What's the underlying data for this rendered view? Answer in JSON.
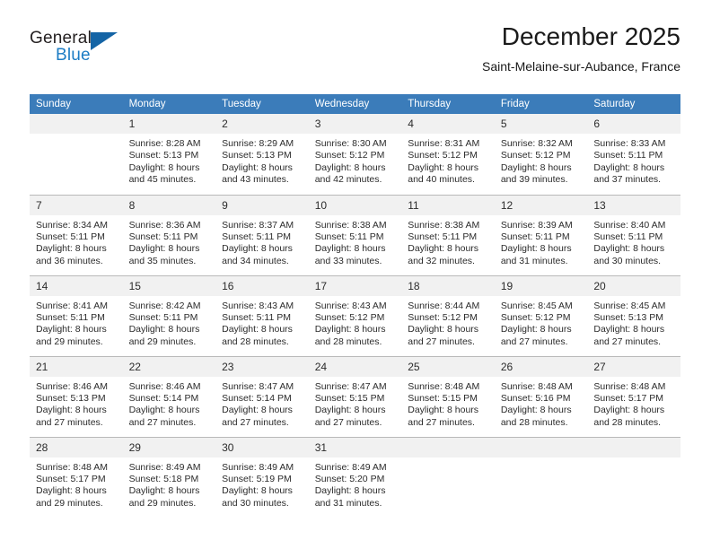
{
  "brand": {
    "name_top": "General",
    "name_bottom": "Blue",
    "triangle_icon": "triangle-icon",
    "color_dark": "#231f20",
    "color_blue": "#1c7cc4"
  },
  "header": {
    "title": "December 2025",
    "subtitle": "Saint-Melaine-sur-Aubance, France"
  },
  "theme": {
    "header_blue": "#3b7cba",
    "daynum_band": "#f1f1f1",
    "grid_line": "#b9b9b9",
    "text": "#2b2b2b"
  },
  "weekday_headers": [
    "Sunday",
    "Monday",
    "Tuesday",
    "Wednesday",
    "Thursday",
    "Friday",
    "Saturday"
  ],
  "labels": {
    "sunrise_prefix": "Sunrise: ",
    "sunset_prefix": "Sunset: ",
    "daylight_prefix": "Daylight: "
  },
  "weeks": [
    [
      {
        "day": "",
        "empty": true
      },
      {
        "day": "1",
        "sunrise": "Sunrise: 8:28 AM",
        "sunset": "Sunset: 5:13 PM",
        "daylight_1": "Daylight: 8 hours",
        "daylight_2": "and 45 minutes."
      },
      {
        "day": "2",
        "sunrise": "Sunrise: 8:29 AM",
        "sunset": "Sunset: 5:13 PM",
        "daylight_1": "Daylight: 8 hours",
        "daylight_2": "and 43 minutes."
      },
      {
        "day": "3",
        "sunrise": "Sunrise: 8:30 AM",
        "sunset": "Sunset: 5:12 PM",
        "daylight_1": "Daylight: 8 hours",
        "daylight_2": "and 42 minutes."
      },
      {
        "day": "4",
        "sunrise": "Sunrise: 8:31 AM",
        "sunset": "Sunset: 5:12 PM",
        "daylight_1": "Daylight: 8 hours",
        "daylight_2": "and 40 minutes."
      },
      {
        "day": "5",
        "sunrise": "Sunrise: 8:32 AM",
        "sunset": "Sunset: 5:12 PM",
        "daylight_1": "Daylight: 8 hours",
        "daylight_2": "and 39 minutes."
      },
      {
        "day": "6",
        "sunrise": "Sunrise: 8:33 AM",
        "sunset": "Sunset: 5:11 PM",
        "daylight_1": "Daylight: 8 hours",
        "daylight_2": "and 37 minutes."
      }
    ],
    [
      {
        "day": "7",
        "sunrise": "Sunrise: 8:34 AM",
        "sunset": "Sunset: 5:11 PM",
        "daylight_1": "Daylight: 8 hours",
        "daylight_2": "and 36 minutes."
      },
      {
        "day": "8",
        "sunrise": "Sunrise: 8:36 AM",
        "sunset": "Sunset: 5:11 PM",
        "daylight_1": "Daylight: 8 hours",
        "daylight_2": "and 35 minutes."
      },
      {
        "day": "9",
        "sunrise": "Sunrise: 8:37 AM",
        "sunset": "Sunset: 5:11 PM",
        "daylight_1": "Daylight: 8 hours",
        "daylight_2": "and 34 minutes."
      },
      {
        "day": "10",
        "sunrise": "Sunrise: 8:38 AM",
        "sunset": "Sunset: 5:11 PM",
        "daylight_1": "Daylight: 8 hours",
        "daylight_2": "and 33 minutes."
      },
      {
        "day": "11",
        "sunrise": "Sunrise: 8:38 AM",
        "sunset": "Sunset: 5:11 PM",
        "daylight_1": "Daylight: 8 hours",
        "daylight_2": "and 32 minutes."
      },
      {
        "day": "12",
        "sunrise": "Sunrise: 8:39 AM",
        "sunset": "Sunset: 5:11 PM",
        "daylight_1": "Daylight: 8 hours",
        "daylight_2": "and 31 minutes."
      },
      {
        "day": "13",
        "sunrise": "Sunrise: 8:40 AM",
        "sunset": "Sunset: 5:11 PM",
        "daylight_1": "Daylight: 8 hours",
        "daylight_2": "and 30 minutes."
      }
    ],
    [
      {
        "day": "14",
        "sunrise": "Sunrise: 8:41 AM",
        "sunset": "Sunset: 5:11 PM",
        "daylight_1": "Daylight: 8 hours",
        "daylight_2": "and 29 minutes."
      },
      {
        "day": "15",
        "sunrise": "Sunrise: 8:42 AM",
        "sunset": "Sunset: 5:11 PM",
        "daylight_1": "Daylight: 8 hours",
        "daylight_2": "and 29 minutes."
      },
      {
        "day": "16",
        "sunrise": "Sunrise: 8:43 AM",
        "sunset": "Sunset: 5:11 PM",
        "daylight_1": "Daylight: 8 hours",
        "daylight_2": "and 28 minutes."
      },
      {
        "day": "17",
        "sunrise": "Sunrise: 8:43 AM",
        "sunset": "Sunset: 5:12 PM",
        "daylight_1": "Daylight: 8 hours",
        "daylight_2": "and 28 minutes."
      },
      {
        "day": "18",
        "sunrise": "Sunrise: 8:44 AM",
        "sunset": "Sunset: 5:12 PM",
        "daylight_1": "Daylight: 8 hours",
        "daylight_2": "and 27 minutes."
      },
      {
        "day": "19",
        "sunrise": "Sunrise: 8:45 AM",
        "sunset": "Sunset: 5:12 PM",
        "daylight_1": "Daylight: 8 hours",
        "daylight_2": "and 27 minutes."
      },
      {
        "day": "20",
        "sunrise": "Sunrise: 8:45 AM",
        "sunset": "Sunset: 5:13 PM",
        "daylight_1": "Daylight: 8 hours",
        "daylight_2": "and 27 minutes."
      }
    ],
    [
      {
        "day": "21",
        "sunrise": "Sunrise: 8:46 AM",
        "sunset": "Sunset: 5:13 PM",
        "daylight_1": "Daylight: 8 hours",
        "daylight_2": "and 27 minutes."
      },
      {
        "day": "22",
        "sunrise": "Sunrise: 8:46 AM",
        "sunset": "Sunset: 5:14 PM",
        "daylight_1": "Daylight: 8 hours",
        "daylight_2": "and 27 minutes."
      },
      {
        "day": "23",
        "sunrise": "Sunrise: 8:47 AM",
        "sunset": "Sunset: 5:14 PM",
        "daylight_1": "Daylight: 8 hours",
        "daylight_2": "and 27 minutes."
      },
      {
        "day": "24",
        "sunrise": "Sunrise: 8:47 AM",
        "sunset": "Sunset: 5:15 PM",
        "daylight_1": "Daylight: 8 hours",
        "daylight_2": "and 27 minutes."
      },
      {
        "day": "25",
        "sunrise": "Sunrise: 8:48 AM",
        "sunset": "Sunset: 5:15 PM",
        "daylight_1": "Daylight: 8 hours",
        "daylight_2": "and 27 minutes."
      },
      {
        "day": "26",
        "sunrise": "Sunrise: 8:48 AM",
        "sunset": "Sunset: 5:16 PM",
        "daylight_1": "Daylight: 8 hours",
        "daylight_2": "and 28 minutes."
      },
      {
        "day": "27",
        "sunrise": "Sunrise: 8:48 AM",
        "sunset": "Sunset: 5:17 PM",
        "daylight_1": "Daylight: 8 hours",
        "daylight_2": "and 28 minutes."
      }
    ],
    [
      {
        "day": "28",
        "sunrise": "Sunrise: 8:48 AM",
        "sunset": "Sunset: 5:17 PM",
        "daylight_1": "Daylight: 8 hours",
        "daylight_2": "and 29 minutes."
      },
      {
        "day": "29",
        "sunrise": "Sunrise: 8:49 AM",
        "sunset": "Sunset: 5:18 PM",
        "daylight_1": "Daylight: 8 hours",
        "daylight_2": "and 29 minutes."
      },
      {
        "day": "30",
        "sunrise": "Sunrise: 8:49 AM",
        "sunset": "Sunset: 5:19 PM",
        "daylight_1": "Daylight: 8 hours",
        "daylight_2": "and 30 minutes."
      },
      {
        "day": "31",
        "sunrise": "Sunrise: 8:49 AM",
        "sunset": "Sunset: 5:20 PM",
        "daylight_1": "Daylight: 8 hours",
        "daylight_2": "and 31 minutes."
      },
      {
        "day": "",
        "empty": true
      },
      {
        "day": "",
        "empty": true
      },
      {
        "day": "",
        "empty": true
      }
    ]
  ]
}
